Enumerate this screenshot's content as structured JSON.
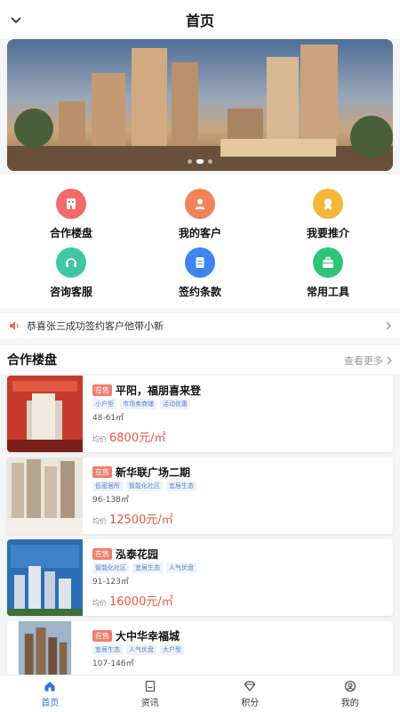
{
  "header": {
    "title": "首页"
  },
  "menu": [
    {
      "label": "合作楼盘",
      "icon": "building-icon",
      "color": "#f26a6a"
    },
    {
      "label": "我的客户",
      "icon": "user-icon",
      "color": "#f2845c"
    },
    {
      "label": "我要推介",
      "icon": "medal-icon",
      "color": "#f5b73a"
    },
    {
      "label": "咨询客服",
      "icon": "headset-icon",
      "color": "#3fc7a5"
    },
    {
      "label": "签约条款",
      "icon": "document-icon",
      "color": "#3b86f0"
    },
    {
      "label": "常用工具",
      "icon": "toolbox-icon",
      "color": "#2fc47a"
    }
  ],
  "notice": {
    "text": "恭喜张三成功签约客户他带小新"
  },
  "section": {
    "title": "合作楼盘",
    "more": "查看更多"
  },
  "properties": [
    {
      "badge": "在售",
      "name": "平阳，福朋喜来登",
      "tags": [
        "小户型",
        "市场卖商铺",
        "活动优惠"
      ],
      "area": "48-61㎡",
      "price_label": "均价",
      "price": "6800元/㎡"
    },
    {
      "badge": "在售",
      "name": "新华联广场二期",
      "tags": [
        "低密居所",
        "智能化社区",
        "宜居生态"
      ],
      "area": "96-138㎡",
      "price_label": "均价",
      "price": "12500元/㎡"
    },
    {
      "badge": "在售",
      "name": "泓泰花园",
      "tags": [
        "智能化社区",
        "宜居生态",
        "人气优盘"
      ],
      "area": "91-123㎡",
      "price_label": "均价",
      "price": "16000元/㎡"
    },
    {
      "badge": "在售",
      "name": "大中华幸福城",
      "tags": [
        "宜居生态",
        "人气优盘",
        "大户型"
      ],
      "area": "107-146㎡",
      "price_label": "",
      "price": ""
    }
  ],
  "tabbar": [
    {
      "label": "首页",
      "active": true
    },
    {
      "label": "资讯",
      "active": false
    },
    {
      "label": "积分",
      "active": false
    },
    {
      "label": "我的",
      "active": false
    }
  ],
  "colors": {
    "accent": "#2f6fe0",
    "price": "#f0563f",
    "badge": "#f07e6e"
  }
}
